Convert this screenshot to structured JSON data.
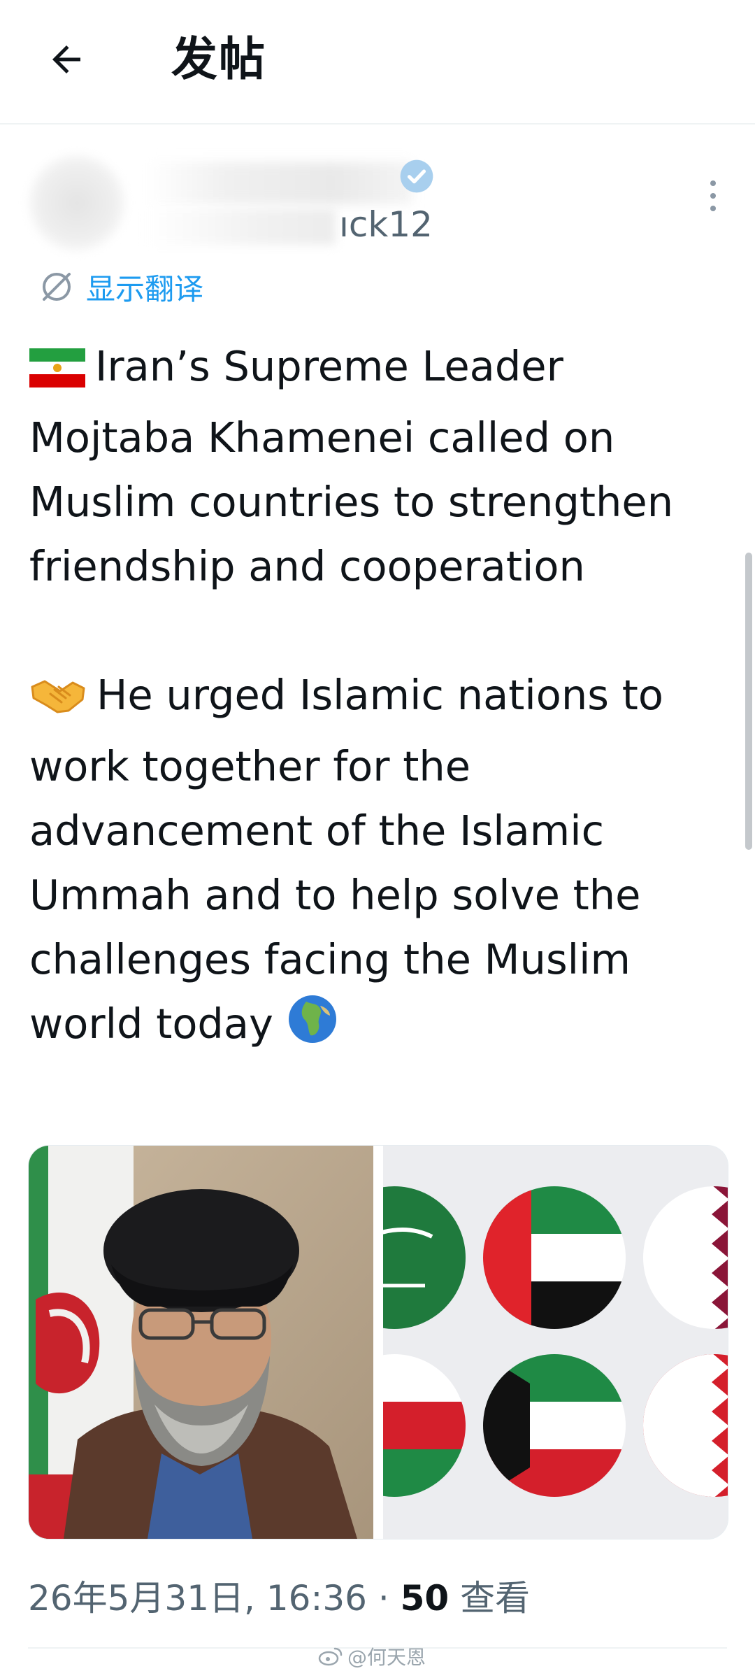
{
  "header": {
    "back_icon": "arrow-left-icon",
    "title": "发帖"
  },
  "author": {
    "handle_visible": "ıck12",
    "verified_icon": "verified-badge-icon",
    "more_icon": "more-vertical-icon"
  },
  "translate": {
    "icon": "translate-icon",
    "label": "显示翻译"
  },
  "post": {
    "paragraph_1": "Iran’s Supreme Leader Mojtaba Khamenei called on Muslim countries to strengthen friendship and cooperation",
    "paragraph_1_icon": "iran-flag-emoji",
    "paragraph_2": "He urged Islamic nations to work together for the advancement of the Islamic Ummah and to help solve the challenges facing the Muslim world today",
    "paragraph_2_icon": "handshake-emoji",
    "paragraph_2_trailing_icon": "globe-emoji"
  },
  "meta": {
    "timestamp": "26年5月31日, 16:36",
    "separator": " · ",
    "views_count": "50",
    "views_label": " 查看"
  },
  "watermark": {
    "text": "@何天恩"
  },
  "colors": {
    "text_primary": "#0f1419",
    "text_secondary": "#536471",
    "accent": "#1d9bf0",
    "divider": "#eff3f4"
  }
}
